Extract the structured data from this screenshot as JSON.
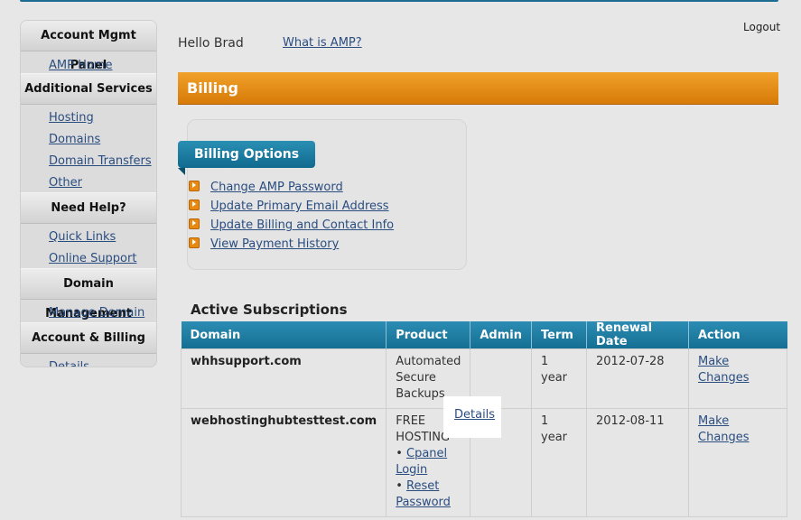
{
  "header": {
    "greeting": "Hello Brad",
    "what_is_amp": "What is AMP?",
    "logout": "Logout"
  },
  "sidebar": {
    "sections": [
      {
        "title": "Account Mgmt Panel",
        "links": [
          "AMP Home"
        ]
      },
      {
        "title": "Additional Services",
        "links": [
          "Hosting",
          "Domains",
          "Domain Transfers",
          "Other"
        ]
      },
      {
        "title": "Need Help?",
        "links": [
          "Quick Links",
          "Online Support"
        ]
      },
      {
        "title": "Domain Management",
        "links": [
          "Manage Domain"
        ]
      },
      {
        "title": "Account & Billing",
        "links": [
          "Details"
        ]
      }
    ]
  },
  "billing": {
    "title": "Billing"
  },
  "billing_options": {
    "title": "Billing Options",
    "items": [
      "Change AMP Password",
      "Update Primary Email Address",
      "Update Billing and Contact Info",
      "View Payment History"
    ]
  },
  "subscriptions": {
    "title": "Active Subscriptions",
    "columns": [
      "Domain",
      "Product",
      "Admin",
      "Term",
      "Renewal Date",
      "Action"
    ],
    "rows": [
      {
        "domain": "whhsupport.com",
        "product_lines": [
          "Automated",
          "Secure",
          "Backups"
        ],
        "admin": "",
        "term": "1 year",
        "renewal": "2012-07-28",
        "action": "Make Changes"
      },
      {
        "domain": "webhostinghubtesttest.com",
        "product_prefix": "FREE HOSTING",
        "product_links": [
          "Cpanel Login",
          "Reset Password"
        ],
        "admin": "Details",
        "term": "1 year",
        "renewal": "2012-08-11",
        "action": "Make Changes"
      }
    ]
  },
  "colors": {
    "accent_blue": "#1d6d93",
    "billing_orange": "#e08a14"
  }
}
